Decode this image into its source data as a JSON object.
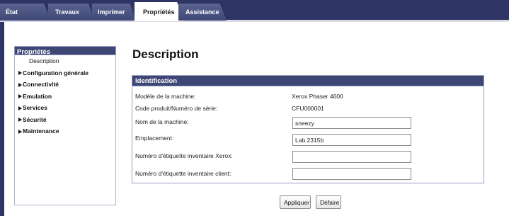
{
  "tabs": [
    {
      "label": "État"
    },
    {
      "label": "Travaux"
    },
    {
      "label": "Imprimer"
    },
    {
      "label": "Propriétés"
    },
    {
      "label": "Assistance"
    }
  ],
  "sidebar": {
    "title": "Propriétés",
    "items": [
      {
        "label": "Description"
      },
      {
        "label": "Configuration générale"
      },
      {
        "label": "Connectivité"
      },
      {
        "label": "Emulation"
      },
      {
        "label": "Services"
      },
      {
        "label": "Sécurité"
      },
      {
        "label": "Maintenance"
      }
    ]
  },
  "main": {
    "title": "Description",
    "section_title": "Identification",
    "model_label": "Modèle de la machine:",
    "model_value": "Xerox Phaser 4600",
    "serial_label": "Code produit/Numéro de série:",
    "serial_value": "CFU000001",
    "name_label": "Nom de la machine:",
    "name_value": "sneezy",
    "location_label": "Emplacement:",
    "location_value": "Lab 2315b",
    "xerox_asset_label": "Numéro d'étiquette inventaire Xerox:",
    "xerox_asset_value": "",
    "client_asset_label": "Numéro d'étiquette inventaire client:",
    "client_asset_value": ""
  },
  "buttons": {
    "apply": "Appliquer",
    "undo": "Défaire"
  }
}
